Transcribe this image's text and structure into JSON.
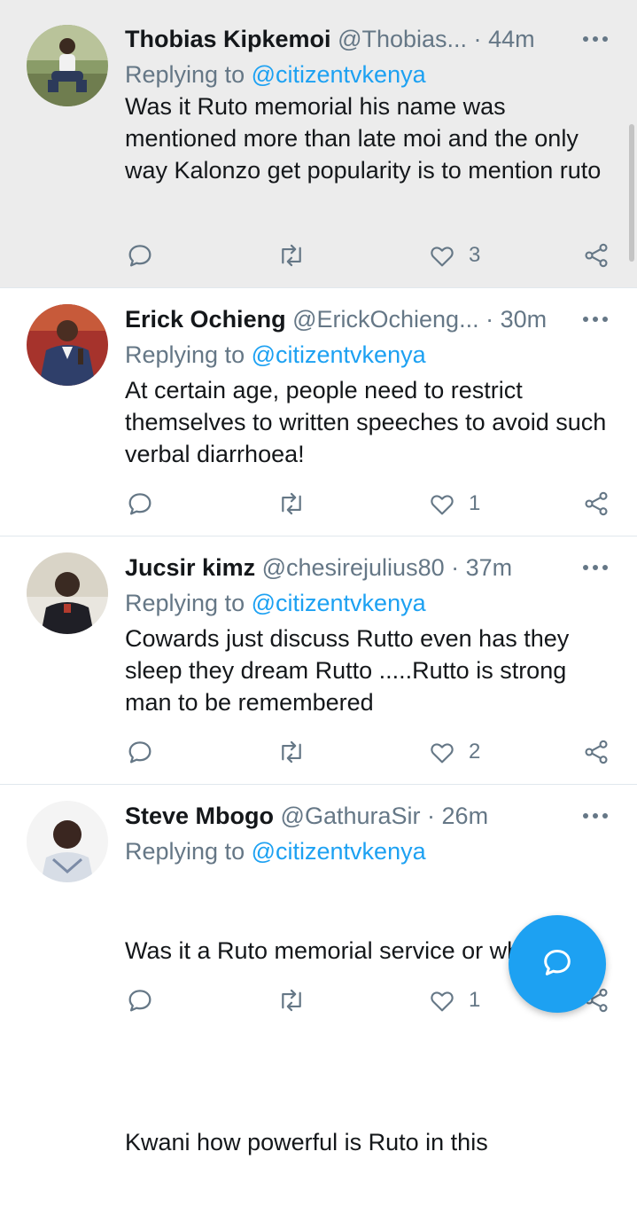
{
  "tweets": [
    {
      "name": "Thobias Kipkemoi",
      "handle": "@Thobias...",
      "separator": "·",
      "time": "44m",
      "replying_prefix": "Replying to",
      "replying_to": "@citizentvkenya",
      "text": "Was it Ruto memorial his name was mentioned more than late moi and the only way Kalonzo get popularity is to mention ruto",
      "likes": "3",
      "highlighted": true
    },
    {
      "name": "Erick Ochieng",
      "handle": "@ErickOchieng...",
      "separator": "·",
      "time": "30m",
      "replying_prefix": "Replying to",
      "replying_to": "@citizentvkenya",
      "text": "At certain age, people need to restrict themselves to written speeches to avoid such verbal diarrhoea!",
      "likes": "1"
    },
    {
      "name": "Jucsir kimz",
      "handle": "@chesirejulius80",
      "separator": "·",
      "time": "37m",
      "replying_prefix": "Replying to",
      "replying_to": "@citizentvkenya",
      "text": "Cowards just discuss Rutto even has they sleep they dream Rutto .....Rutto is strong man to be remembered",
      "likes": "2"
    },
    {
      "name": "Steve Mbogo",
      "handle": "@GathuraSir",
      "separator": "·",
      "time": "26m",
      "replying_prefix": "Replying to",
      "replying_to": "@citizentvkenya",
      "text_line1": "Was it a Ruto memorial service or what??",
      "text_line2": "Kwani how powerful is Ruto in this",
      "likes": "1"
    }
  ],
  "icons": {
    "more": "more-options-icon",
    "reply": "reply-icon",
    "retweet": "retweet-icon",
    "like": "heart-icon",
    "share": "share-icon",
    "compose": "compose-reply-icon",
    "emoji": "thinking-face-emoji"
  },
  "colors": {
    "accent": "#1da1f2",
    "secondary_text": "#657786",
    "highlight_bg": "#ececec",
    "divider": "#e1e8ed"
  }
}
